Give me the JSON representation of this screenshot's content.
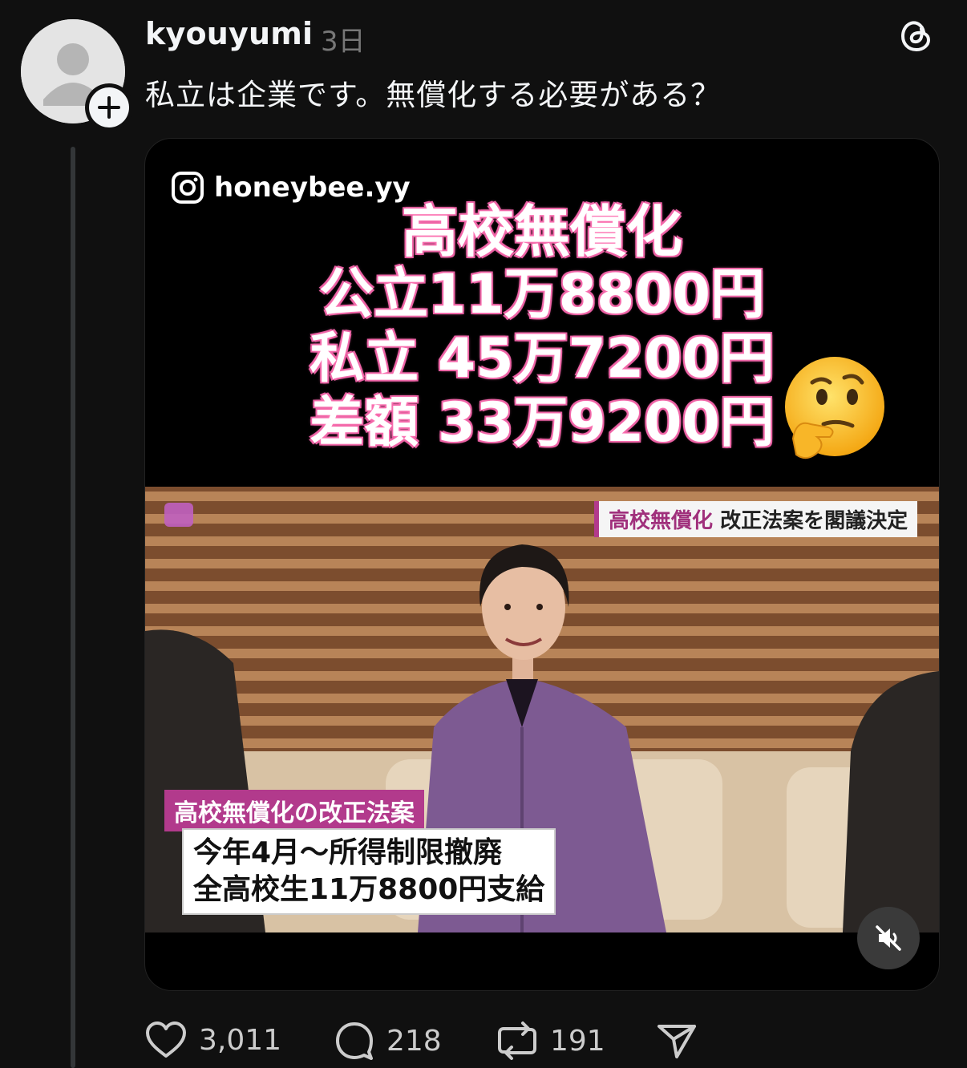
{
  "post": {
    "username": "kyouyumi",
    "timestamp": "3日",
    "text": "私立は企業です。無償化する必要がある？"
  },
  "media": {
    "ig_handle": "honeybee.yy",
    "overlay_title": "高校無償化",
    "overlay_lines": [
      "公立11万8800円",
      "私立 45万7200円",
      "差額 33万9200円"
    ],
    "news_tag_highlight": "高校無償化",
    "news_tag_rest": "改正法案を閣議決定",
    "caption_tag": "高校無償化の改正法案",
    "caption_lines": [
      "今年4月～所得制限撤廃",
      "全高校生11万8800円支給"
    ]
  },
  "actions": {
    "likes": "3,011",
    "replies": "218",
    "reposts": "191"
  },
  "colors": {
    "background": "#101010",
    "text": "#f3f5f7",
    "muted": "#777777",
    "overlay_glow": "#ff6fb0"
  },
  "icons": [
    "threads-icon",
    "instagram-icon",
    "thinking-face-emoji",
    "mute-icon",
    "heart-icon",
    "comment-icon",
    "repost-icon",
    "share-icon",
    "plus-icon"
  ]
}
